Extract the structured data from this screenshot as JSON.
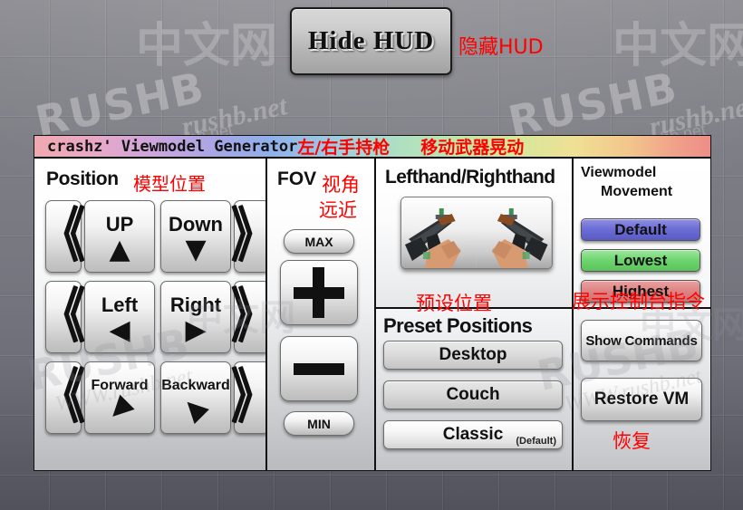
{
  "hud": {
    "hide_button_label": "Hide HUD",
    "hide_button_cn": "隐藏HUD"
  },
  "window": {
    "title_en": "crashz' Viewmodel Generator",
    "title_cn_left": "左/右手持枪",
    "title_cn_right": "移动武器晃动"
  },
  "watermarks": {
    "brand": "RUSHB",
    "site": "rushb.net",
    "url": "WWW.rushb.net",
    "cn": "中文网"
  },
  "position_panel": {
    "heading": "Position",
    "heading_cn": "模型位置",
    "chevron_left": "《",
    "chevron_right": "》",
    "rows": [
      {
        "left_label": "UP",
        "left_arrow": "▲",
        "right_label": "Down",
        "right_arrow": "▼"
      },
      {
        "left_label": "Left",
        "left_arrow": "◀",
        "right_label": "Right",
        "right_arrow": "▶"
      },
      {
        "left_label": "Forward",
        "left_arrow": "◀",
        "right_label": "Backward",
        "right_arrow": "◀"
      }
    ]
  },
  "fov_panel": {
    "heading": "FOV",
    "heading_cn_1": "视角",
    "heading_cn_2": "远近",
    "max_label": "MAX",
    "min_label": "MIN",
    "plus_icon": "plus-icon",
    "minus_icon": "minus-icon"
  },
  "hand_panel": {
    "heading": "Lefthand/Righthand",
    "left_thumb": "viewmodel-lefthand-thumbnail",
    "right_thumb": "viewmodel-righthand-thumbnail"
  },
  "preset_panel": {
    "heading": "Preset Positions",
    "heading_cn": "预设位置",
    "buttons": [
      {
        "label": "Desktop",
        "sub": ""
      },
      {
        "label": "Couch",
        "sub": ""
      },
      {
        "label": "Classic",
        "sub": "(Default)"
      }
    ]
  },
  "movement_panel": {
    "heading_line1": "Viewmodel",
    "heading_line2": "Movement",
    "buttons": [
      {
        "label": "Default",
        "color": "#6e6ed6"
      },
      {
        "label": "Lowest",
        "color": "#70d770"
      },
      {
        "label": "Highest",
        "color": "#df8686"
      }
    ]
  },
  "commands_panel": {
    "heading_cn": "展示控制台指令",
    "show_commands_label": "Show Commands",
    "restore_label": "Restore VM",
    "restore_cn": "恢复"
  }
}
